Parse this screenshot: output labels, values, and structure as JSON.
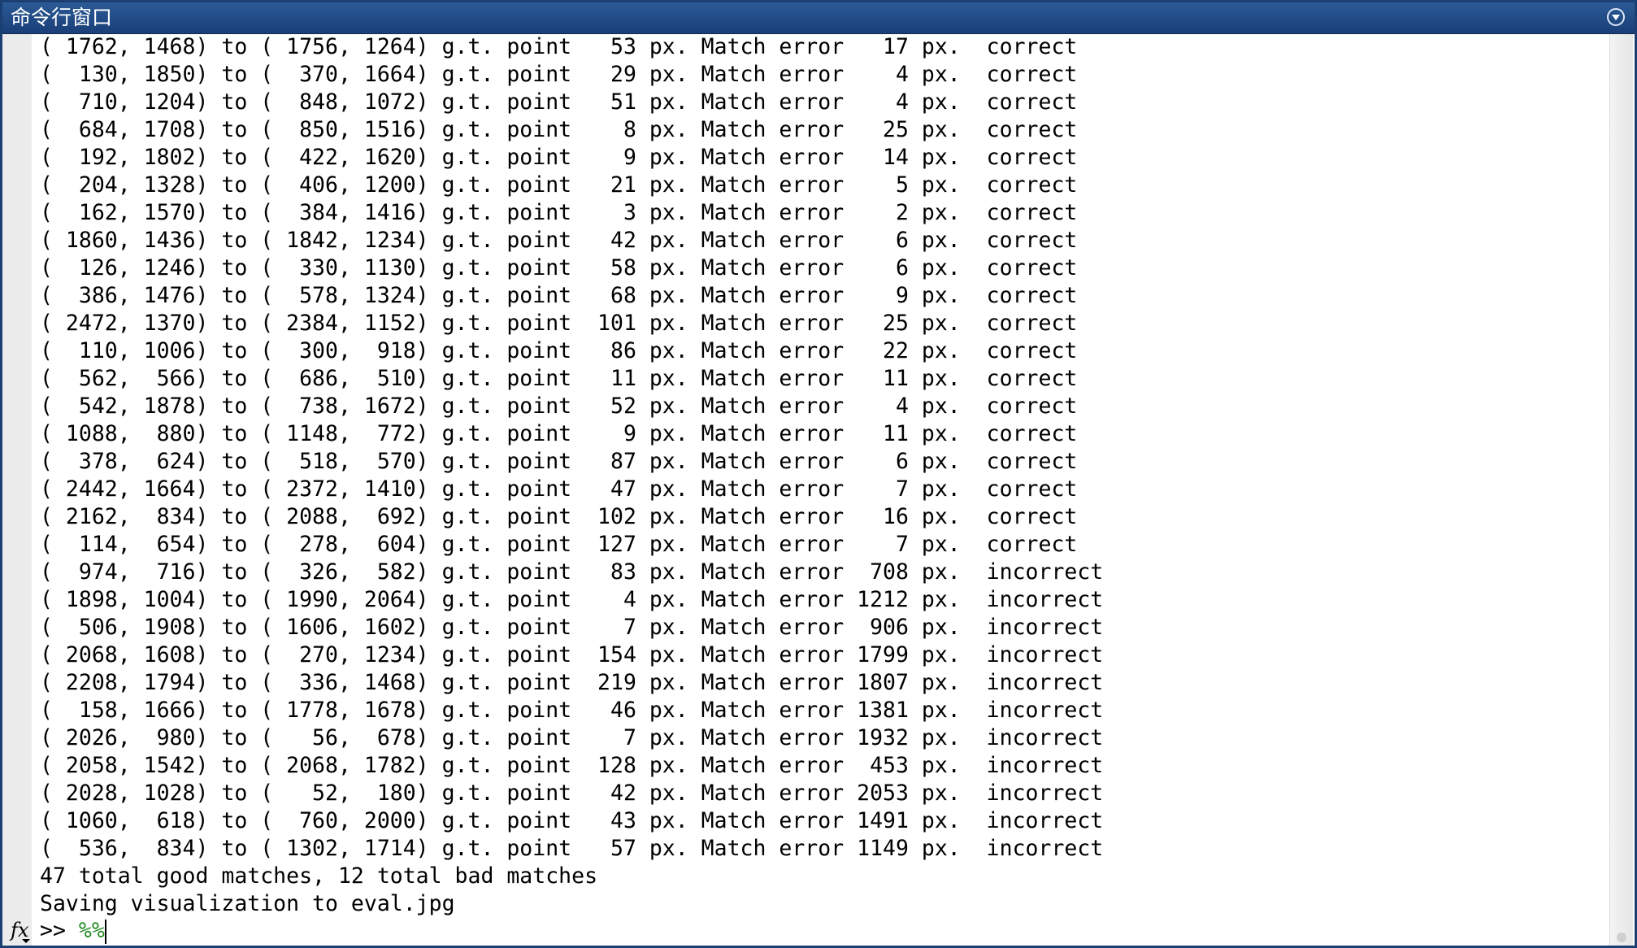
{
  "window": {
    "title": "命令行窗口"
  },
  "output_lines": [
    "( 1762, 1468) to ( 1756, 1264) g.t. point   53 px. Match error   17 px.  correct",
    "(  130, 1850) to (  370, 1664) g.t. point   29 px. Match error    4 px.  correct",
    "(  710, 1204) to (  848, 1072) g.t. point   51 px. Match error    4 px.  correct",
    "(  684, 1708) to (  850, 1516) g.t. point    8 px. Match error   25 px.  correct",
    "(  192, 1802) to (  422, 1620) g.t. point    9 px. Match error   14 px.  correct",
    "(  204, 1328) to (  406, 1200) g.t. point   21 px. Match error    5 px.  correct",
    "(  162, 1570) to (  384, 1416) g.t. point    3 px. Match error    2 px.  correct",
    "( 1860, 1436) to ( 1842, 1234) g.t. point   42 px. Match error    6 px.  correct",
    "(  126, 1246) to (  330, 1130) g.t. point   58 px. Match error    6 px.  correct",
    "(  386, 1476) to (  578, 1324) g.t. point   68 px. Match error    9 px.  correct",
    "( 2472, 1370) to ( 2384, 1152) g.t. point  101 px. Match error   25 px.  correct",
    "(  110, 1006) to (  300,  918) g.t. point   86 px. Match error   22 px.  correct",
    "(  562,  566) to (  686,  510) g.t. point   11 px. Match error   11 px.  correct",
    "(  542, 1878) to (  738, 1672) g.t. point   52 px. Match error    4 px.  correct",
    "( 1088,  880) to ( 1148,  772) g.t. point    9 px. Match error   11 px.  correct",
    "(  378,  624) to (  518,  570) g.t. point   87 px. Match error    6 px.  correct",
    "( 2442, 1664) to ( 2372, 1410) g.t. point   47 px. Match error    7 px.  correct",
    "( 2162,  834) to ( 2088,  692) g.t. point  102 px. Match error   16 px.  correct",
    "(  114,  654) to (  278,  604) g.t. point  127 px. Match error    7 px.  correct",
    "(  974,  716) to (  326,  582) g.t. point   83 px. Match error  708 px.  incorrect",
    "( 1898, 1004) to ( 1990, 2064) g.t. point    4 px. Match error 1212 px.  incorrect",
    "(  506, 1908) to ( 1606, 1602) g.t. point    7 px. Match error  906 px.  incorrect",
    "( 2068, 1608) to (  270, 1234) g.t. point  154 px. Match error 1799 px.  incorrect",
    "( 2208, 1794) to (  336, 1468) g.t. point  219 px. Match error 1807 px.  incorrect",
    "(  158, 1666) to ( 1778, 1678) g.t. point   46 px. Match error 1381 px.  incorrect",
    "( 2026,  980) to (   56,  678) g.t. point    7 px. Match error 1932 px.  incorrect",
    "( 2058, 1542) to ( 2068, 1782) g.t. point  128 px. Match error  453 px.  incorrect",
    "( 2028, 1028) to (   52,  180) g.t. point   42 px. Match error 2053 px.  incorrect",
    "( 1060,  618) to (  760, 2000) g.t. point   43 px. Match error 1491 px.  incorrect",
    "(  536,  834) to ( 1302, 1714) g.t. point   57 px. Match error 1149 px.  incorrect",
    "47 total good matches, 12 total bad matches",
    "Saving visualization to eval.jpg"
  ],
  "prompt": {
    "fx_label": "fx",
    "symbol": ">> ",
    "command": "%%"
  },
  "colors": {
    "titlebar": "#1f4a85",
    "command": "#228b22"
  }
}
